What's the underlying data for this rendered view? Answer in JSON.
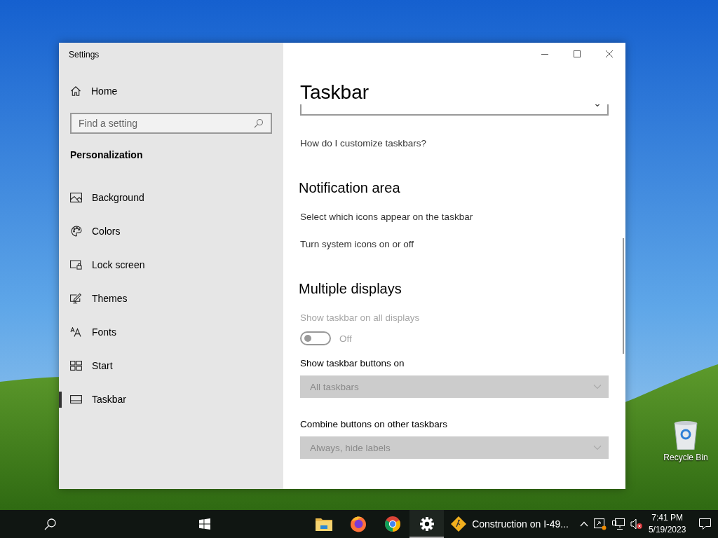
{
  "window": {
    "title": "Settings"
  },
  "sidebar": {
    "home": "Home",
    "search": {
      "placeholder": "Find a setting"
    },
    "section": "Personalization",
    "items": [
      {
        "label": "Background",
        "kind": "background",
        "selected": false
      },
      {
        "label": "Colors",
        "kind": "colors",
        "selected": false
      },
      {
        "label": "Lock screen",
        "kind": "lock",
        "selected": false
      },
      {
        "label": "Themes",
        "kind": "themes",
        "selected": false
      },
      {
        "label": "Fonts",
        "kind": "fonts",
        "selected": false
      },
      {
        "label": "Start",
        "kind": "start",
        "selected": false
      },
      {
        "label": "Taskbar",
        "kind": "taskbar",
        "selected": true
      }
    ]
  },
  "page": {
    "title": "Taskbar",
    "rows": [
      {
        "kind": "dropdown",
        "disabled": false
      },
      {
        "kind": "link",
        "text": "How do I customize taskbars?"
      },
      {
        "kind": "heading",
        "text": "Notification area"
      },
      {
        "kind": "link",
        "text": "Select which icons appear on the taskbar"
      },
      {
        "kind": "link",
        "text": "Turn system icons on or off"
      },
      {
        "kind": "heading",
        "text": "Multiple displays"
      },
      {
        "kind": "toggle",
        "label": "Show taskbar on all displays",
        "on": false,
        "state_text": "Off",
        "disabled": true
      },
      {
        "kind": "dropdown",
        "label": "Show taskbar buttons on",
        "value": "All taskbars",
        "disabled": true
      },
      {
        "kind": "dropdown",
        "label": "Combine buttons on other taskbars",
        "value": "Always, hide labels",
        "disabled": true
      }
    ]
  },
  "desktop_icons": [
    {
      "label": "Recycle Bin"
    }
  ],
  "taskbar": {
    "apps": [
      {
        "kind": "folder",
        "active": false
      },
      {
        "kind": "firefox",
        "active": false
      },
      {
        "kind": "chrome",
        "active": false
      },
      {
        "kind": "gear",
        "active": true
      }
    ],
    "news": {
      "text": "Construction on I-49..."
    },
    "clock": {
      "time": "7:41 PM",
      "date": "5/19/2023"
    }
  }
}
